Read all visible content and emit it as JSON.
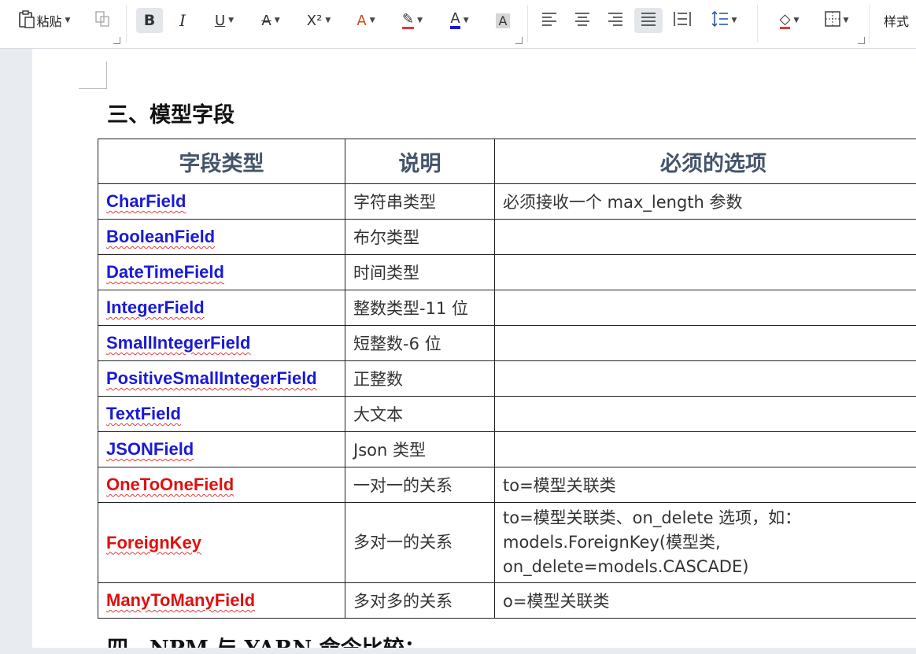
{
  "toolbar": {
    "paste_label": "粘贴",
    "style_label": "样式",
    "icons": [
      "paste-icon",
      "format-painter-icon",
      "bold-icon",
      "italic-icon",
      "underline-icon",
      "strikethrough-icon",
      "superscript-icon",
      "text-effect-icon",
      "highlight-icon",
      "font-color-icon",
      "char-shading-icon",
      "align-left-icon",
      "align-center-icon",
      "align-right-icon",
      "justify-icon",
      "distributed-icon",
      "line-spacing-icon",
      "shading-icon",
      "borders-icon"
    ],
    "font_color": "#1a1ad6"
  },
  "document": {
    "heading": "三、模型字段",
    "next_heading": "四、NPM 与 YARN 命令比较：",
    "table": {
      "headers": [
        "字段类型",
        "说明",
        "必须的选项"
      ],
      "rows": [
        {
          "field": "CharField",
          "color": "blue",
          "desc": "字符串类型",
          "option": "必须接收一个 max_length 参数"
        },
        {
          "field": "BooleanField",
          "color": "blue",
          "desc": "布尔类型",
          "option": ""
        },
        {
          "field": "DateTimeField",
          "color": "blue",
          "desc": "时间类型",
          "option": ""
        },
        {
          "field": "IntegerField",
          "color": "blue",
          "desc": "整数类型-11 位",
          "option": ""
        },
        {
          "field": "SmallIntegerField",
          "color": "blue",
          "desc": "短整数-6 位",
          "option": ""
        },
        {
          "field": "PositiveSmallIntegerField",
          "color": "blue",
          "desc": "正整数",
          "option": ""
        },
        {
          "field": "TextField",
          "color": "blue",
          "desc": "大文本",
          "option": ""
        },
        {
          "field": "JSONField",
          "color": "blue",
          "desc": "Json 类型",
          "option": ""
        },
        {
          "field": "OneToOneField",
          "color": "red",
          "desc": "一对一的关系",
          "option": "to=模型关联类"
        },
        {
          "field": "ForeignKey",
          "color": "red",
          "desc": "多对一的关系",
          "option": "to=模型关联类、on_delete 选项，如：models.ForeignKey(模型类, on_delete=models.CASCADE)"
        },
        {
          "field": "ManyToManyField",
          "color": "red",
          "desc": "多对多的关系",
          "option": "o=模型关联类"
        }
      ]
    }
  }
}
